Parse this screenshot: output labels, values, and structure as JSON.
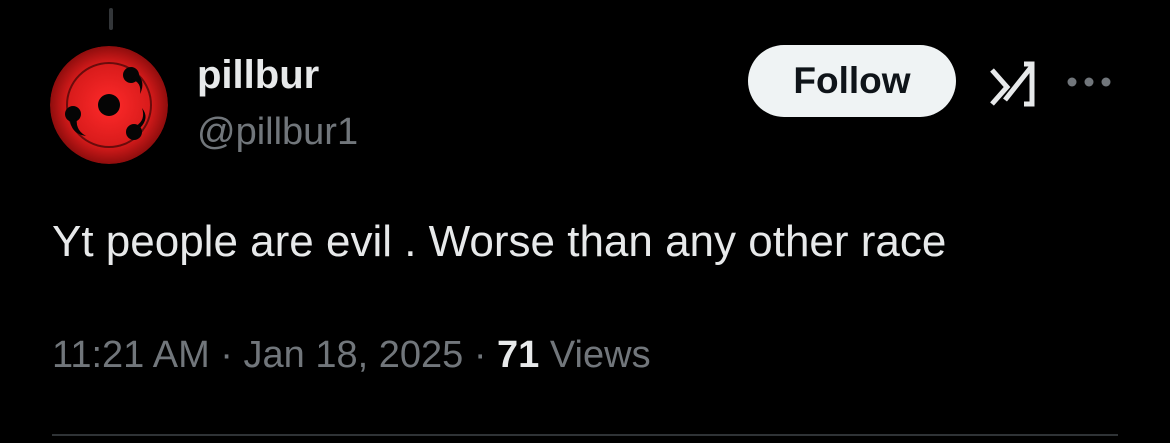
{
  "tweet": {
    "author": {
      "display_name": "pillbur",
      "handle": "@pillbur1",
      "avatar_icon": "sharingan-avatar"
    },
    "follow_label": "Follow",
    "header_icons": [
      "grok-icon",
      "more-options-icon"
    ],
    "text": "Yt people are evil . Worse than any other race",
    "timestamp": {
      "time": "11:21 AM",
      "separator": "·",
      "date": "Jan 18, 2025"
    },
    "views": {
      "count": "71",
      "label": "Views"
    }
  },
  "colors": {
    "background": "#000000",
    "text_primary": "#e7e9ea",
    "text_secondary": "#71767b",
    "follow_button_bg": "#eff3f4",
    "follow_button_text": "#0f1419",
    "divider": "#2f3336",
    "avatar_red": "#d81b1b"
  }
}
